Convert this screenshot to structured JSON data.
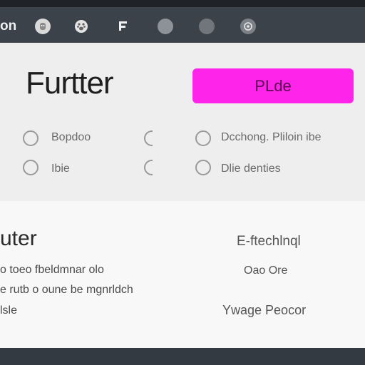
{
  "toolbar": {
    "left_label": "on",
    "icons": [
      "robot-icon",
      "paw-icon",
      "editor-icon",
      "circle-icon",
      "circle-icon",
      "user-icon"
    ]
  },
  "header": {
    "title": "Furtter",
    "primary_button": "PLde"
  },
  "options": {
    "col1": [
      "Bopdoo",
      "Ibie"
    ],
    "col3": [
      "Dcchong. Pliloin ibe",
      "Dlie denties"
    ]
  },
  "section": {
    "title": "uter",
    "body_lines": [
      "o toeo fbeldmnar olo",
      "e rutb o oune be mgnrldch",
      "lsle"
    ],
    "right": {
      "heading": "E-ftechlnql",
      "line1": "Oao Ore",
      "line2": "Ywage Peocor"
    }
  },
  "colors": {
    "accent": "#ff24e9",
    "topbar": "#3c424a",
    "panel": "#eeeeee"
  }
}
